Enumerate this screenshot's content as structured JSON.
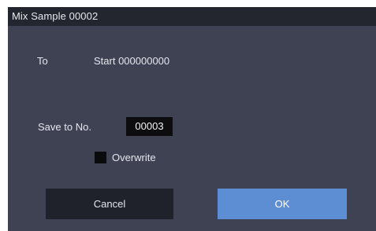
{
  "dialog": {
    "title": "Mix Sample 00002",
    "to_label": "To",
    "to_value": "Start 000000000",
    "save_label": "Save to No.",
    "save_number": "00003",
    "overwrite_label": "Overwrite",
    "overwrite_checked": false,
    "cancel_label": "Cancel",
    "ok_label": "OK"
  },
  "colors": {
    "dialog_background": "#3f4252",
    "titlebar_background": "#23252f",
    "cancel_background": "#1f212b",
    "ok_background": "#5d8ed4",
    "field_background": "#0d0d10"
  }
}
